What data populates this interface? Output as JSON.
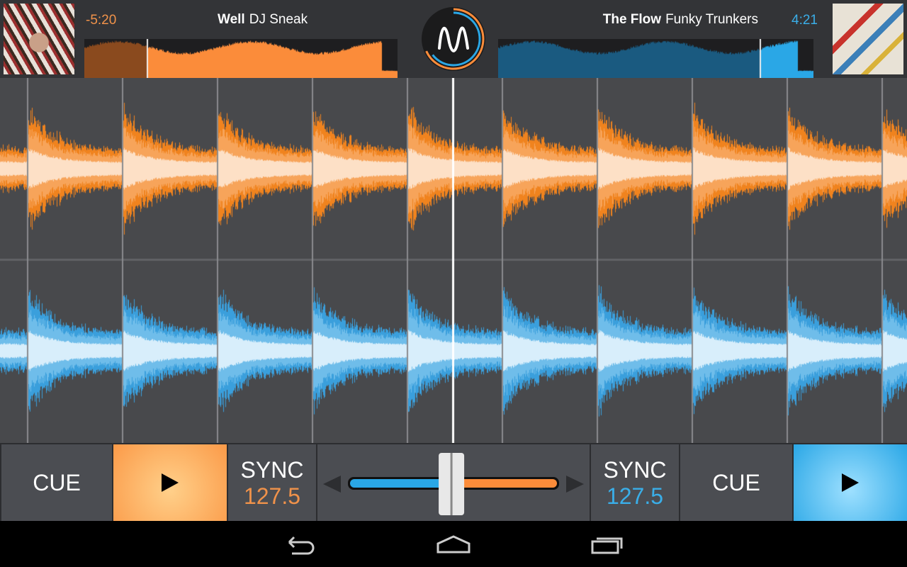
{
  "deck_left": {
    "time": "-5:20",
    "title": "Well",
    "artist": "DJ Sneak",
    "progress": 0.2,
    "color": "#fb8c3a",
    "sync_label": "SYNC",
    "bpm": "127.5",
    "cue_label": "CUE",
    "art": "album-art-headdress"
  },
  "deck_right": {
    "time": "4:21",
    "title": "The Flow",
    "artist": "Funky Trunkers",
    "progress": 0.83,
    "color": "#2aa7e6",
    "sync_label": "SYNC",
    "bpm": "127.5",
    "cue_label": "CUE",
    "art": "album-art-closed-expansion"
  },
  "crossfader": {
    "position": 0.49
  },
  "nav": {
    "icons": [
      "back-icon",
      "home-icon",
      "recent-apps-icon"
    ]
  }
}
